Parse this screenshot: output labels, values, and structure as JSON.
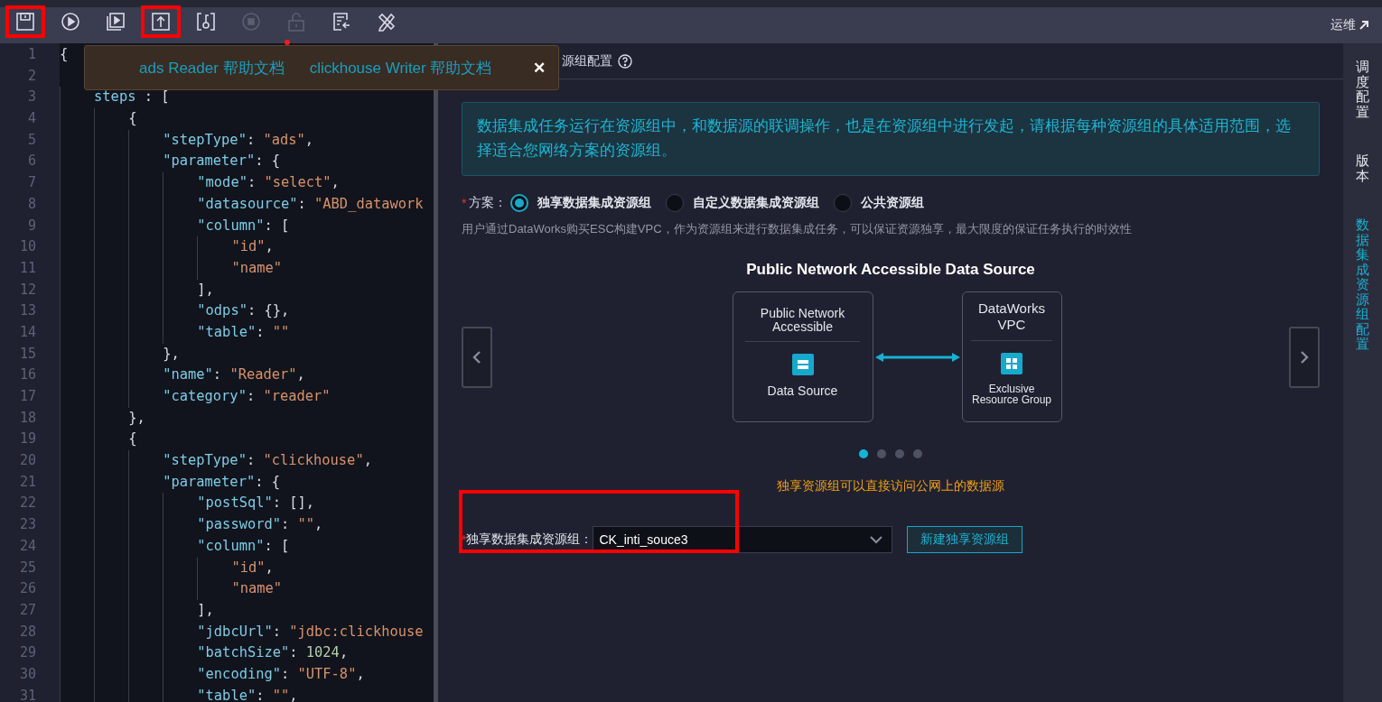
{
  "toolbar": {
    "buttons": [
      {
        "highlighted": true,
        "disabled": false
      },
      {
        "highlighted": false,
        "disabled": false
      },
      {
        "highlighted": false,
        "disabled": false
      },
      {
        "highlighted": true,
        "disabled": false
      },
      {
        "highlighted": false,
        "disabled": false
      },
      {
        "highlighted": false,
        "disabled": true
      },
      {
        "highlighted": false,
        "disabled": true
      },
      {
        "highlighted": false,
        "disabled": false
      },
      {
        "highlighted": false,
        "disabled": false
      }
    ],
    "ops_link": "运维"
  },
  "popup": {
    "links": [
      "ads Reader 帮助文档",
      "clickhouse Writer 帮助文档"
    ],
    "close": "✕"
  },
  "editor": {
    "lines": [
      {
        "n": "1",
        "text": "{"
      },
      {
        "n": "2"
      },
      {
        "n": "3",
        "text": "    steps : ["
      },
      {
        "n": "4",
        "text": "        {"
      },
      {
        "n": "5",
        "text": "            \"stepType\": \"ads\","
      },
      {
        "n": "6",
        "text": "            \"parameter\": {"
      },
      {
        "n": "7",
        "text": "                \"mode\": \"select\","
      },
      {
        "n": "8",
        "text": "                \"datasource\": \"ABD_datawork"
      },
      {
        "n": "9",
        "text": "                \"column\": ["
      },
      {
        "n": "10",
        "text": "                    \"id\","
      },
      {
        "n": "11",
        "text": "                    \"name\""
      },
      {
        "n": "12",
        "text": "                ],"
      },
      {
        "n": "13",
        "text": "                \"odps\": {},"
      },
      {
        "n": "14",
        "text": "                \"table\": \"\""
      },
      {
        "n": "15",
        "text": "            },"
      },
      {
        "n": "16",
        "text": "            \"name\": \"Reader\","
      },
      {
        "n": "17",
        "text": "            \"category\": \"reader\""
      },
      {
        "n": "18",
        "text": "        },"
      },
      {
        "n": "19",
        "text": "        {"
      },
      {
        "n": "20",
        "text": "            \"stepType\": \"clickhouse\","
      },
      {
        "n": "21",
        "text": "            \"parameter\": {"
      },
      {
        "n": "22",
        "text": "                \"postSql\": [],"
      },
      {
        "n": "23",
        "text": "                \"password\": \"\","
      },
      {
        "n": "24",
        "text": "                \"column\": ["
      },
      {
        "n": "25",
        "text": "                    \"id\","
      },
      {
        "n": "26",
        "text": "                    \"name\""
      },
      {
        "n": "27",
        "text": "                ],"
      },
      {
        "n": "28",
        "text": "                \"jdbcUrl\": \"jdbc:clickhouse"
      },
      {
        "n": "29",
        "text": "                \"batchSize\": 1024,"
      },
      {
        "n": "30",
        "text": "                \"encoding\": \"UTF-8\","
      },
      {
        "n": "31",
        "text": "                \"table\": \"\","
      }
    ]
  },
  "panel": {
    "tab_title": "源组配置",
    "info": "数据集成任务运行在资源组中，和数据源的联调操作，也是在资源组中进行发起，请根据每种资源组的具体适用范围，选择适合您网络方案的资源组。",
    "scheme": {
      "required_mark": "*",
      "label": "方案：",
      "options": [
        {
          "label": "独享数据集成资源组",
          "selected": true
        },
        {
          "label": "自定义数据集成资源组",
          "selected": false
        },
        {
          "label": "公共资源组",
          "selected": false
        }
      ]
    },
    "description": "用户通过DataWorks购买ESC构建VPC，作为资源组来进行数据集成任务，可以保证资源独享，最大限度的保证任务执行的时效性",
    "carousel": {
      "title": "Public Network Accessible Data Source",
      "source_box": {
        "title": "Public Network Accessible",
        "label": "Data Source"
      },
      "target_box": {
        "title": "DataWorks VPC",
        "label": "Exclusive Resource Group"
      },
      "dots": [
        {
          "selected": true
        },
        {
          "selected": false
        },
        {
          "selected": false
        },
        {
          "selected": false
        }
      ]
    },
    "note": "独享资源组可以直接访问公网上的数据源",
    "resource_group": {
      "required_mark": "*",
      "label": "独享数据集成资源组：",
      "value": "CK_inti_souce3",
      "highlighted": true
    },
    "new_button": "新建独享资源组"
  },
  "side_tabs": [
    {
      "label": "调度配置",
      "selected": false
    },
    {
      "label": "版本",
      "selected": false
    },
    {
      "label": "数据集成资源组配置",
      "selected": true
    }
  ]
}
